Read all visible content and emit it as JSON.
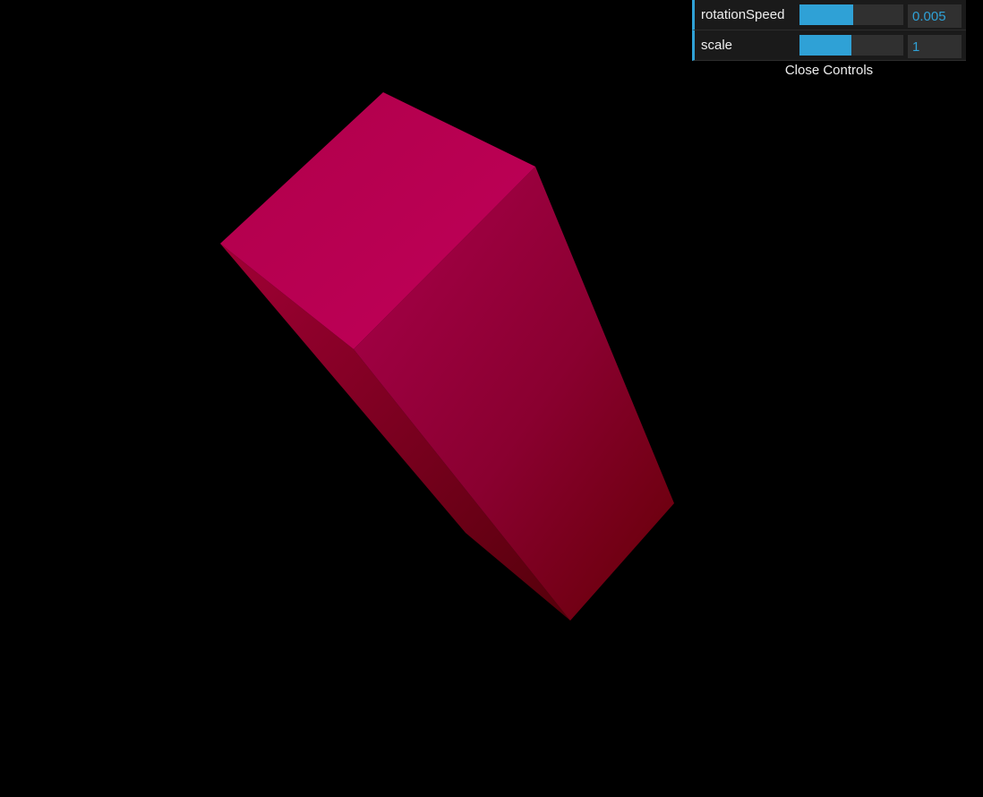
{
  "scene": {
    "background": "#000000",
    "object": "cube",
    "face_colors": {
      "top": "#b8004f",
      "right_light": "#aa0048",
      "right_dark": "#6e0008",
      "left_light": "#9a002c",
      "left_dark": "#5a0008"
    }
  },
  "gui": {
    "accent": "#2fa1d6",
    "controls": [
      {
        "label": "rotationSpeed",
        "value": "0.005",
        "fill": 0.52
      },
      {
        "label": "scale",
        "value": "1",
        "fill": 0.5
      }
    ],
    "close_label": "Close Controls"
  }
}
